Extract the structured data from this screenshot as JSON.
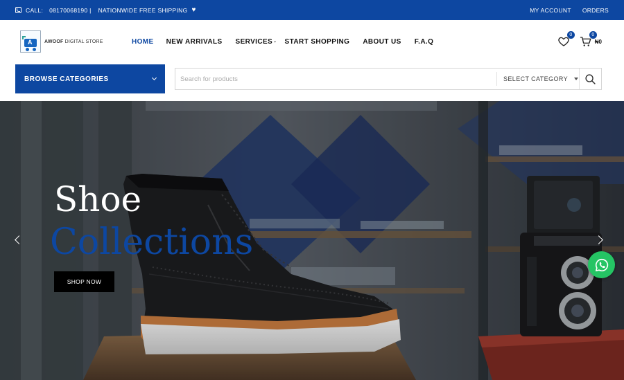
{
  "topbar": {
    "call_label": "CALL:",
    "phone": "08170068190 |",
    "shipping": "NATIONWIDE FREE SHIPPING",
    "my_account": "MY ACCOUNT",
    "orders": "ORDERS"
  },
  "logo": {
    "brand_bold": "AWOOF",
    "brand_rest": "DIGITAL STORE"
  },
  "nav": [
    {
      "label": "HOME",
      "active": true
    },
    {
      "label": "NEW ARRIVALS"
    },
    {
      "label": "SERVICES",
      "has_caret": true
    },
    {
      "label": "START SHOPPING"
    },
    {
      "label": "ABOUT US"
    },
    {
      "label": "F.A.Q"
    }
  ],
  "header_icons": {
    "wishlist_count": "0",
    "cart_count": "0",
    "cart_total": "₦0"
  },
  "categories_button": "BROWSE CATEGORIES",
  "search": {
    "placeholder": "Search for products",
    "select_value": "SELECT CATEGORY"
  },
  "hero": {
    "title_line1": "Shoe",
    "title_line2": "Collections",
    "cta": "SHOP NOW"
  },
  "colors": {
    "brand_blue": "#0d47a1",
    "whatsapp_green": "#25c464"
  },
  "icons": [
    "phone-icon",
    "heart-icon",
    "wishlist-heart-icon",
    "cart-icon",
    "chevron-down-icon",
    "search-icon",
    "whatsapp-icon",
    "arrow-left-icon",
    "arrow-right-icon"
  ]
}
